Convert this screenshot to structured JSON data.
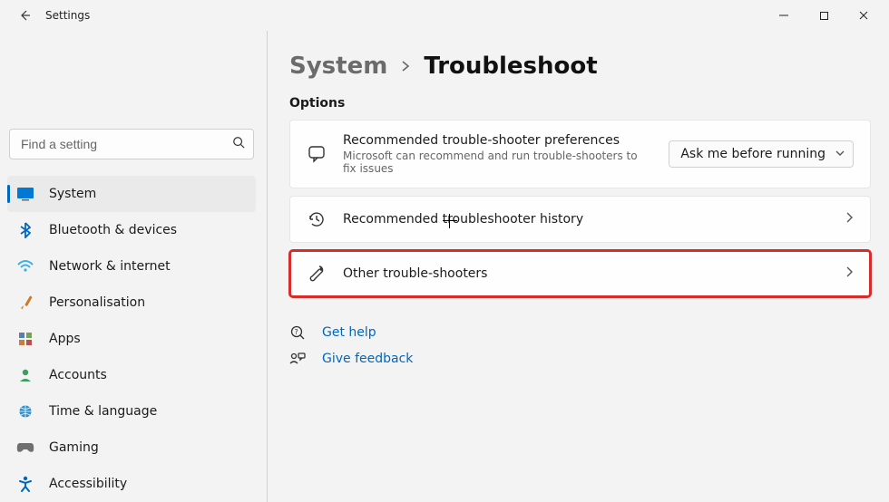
{
  "app": {
    "title": "Settings"
  },
  "search": {
    "placeholder": "Find a setting"
  },
  "sidebar": {
    "items": [
      {
        "label": "System"
      },
      {
        "label": "Bluetooth & devices"
      },
      {
        "label": "Network & internet"
      },
      {
        "label": "Personalisation"
      },
      {
        "label": "Apps"
      },
      {
        "label": "Accounts"
      },
      {
        "label": "Time & language"
      },
      {
        "label": "Gaming"
      },
      {
        "label": "Accessibility"
      }
    ]
  },
  "breadcrumb": {
    "parent": "System",
    "current": "Troubleshoot"
  },
  "main": {
    "options_header": "Options",
    "card_pref": {
      "title": "Recommended trouble-shooter preferences",
      "subtitle": "Microsoft can recommend and run trouble-shooters to fix issues",
      "dropdown_value": "Ask me before running"
    },
    "card_history": {
      "title": "Recommended troubleshooter history"
    },
    "card_other": {
      "title": "Other trouble-shooters"
    }
  },
  "help": {
    "get_help": "Get help",
    "give_feedback": "Give feedback"
  }
}
